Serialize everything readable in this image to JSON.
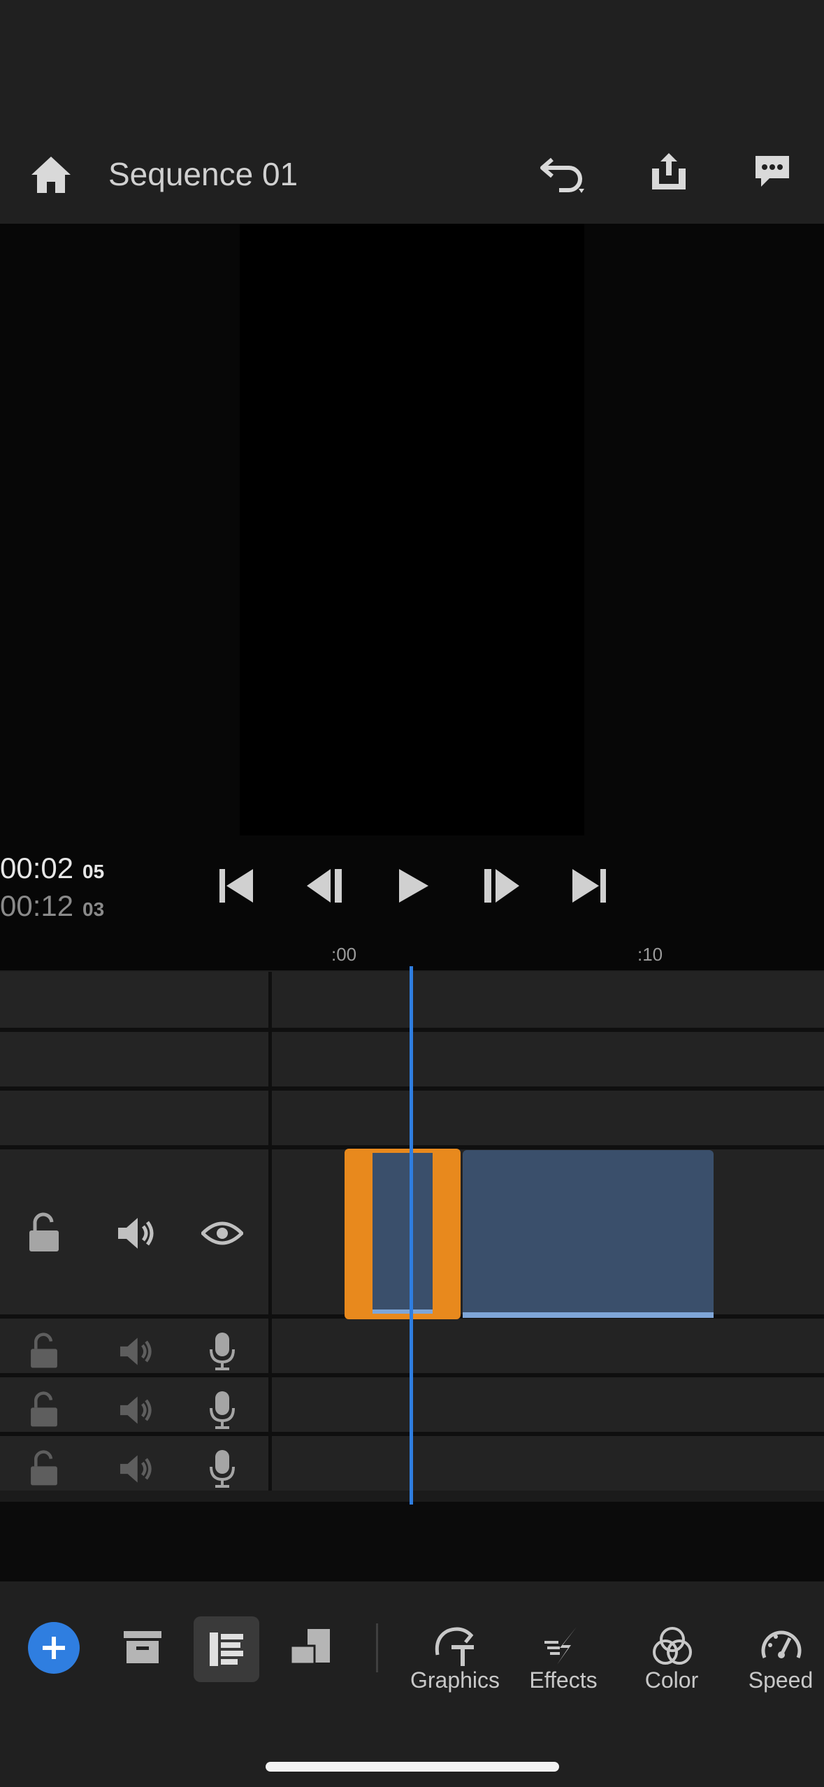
{
  "header": {
    "title": "Sequence 01",
    "icons": [
      "home-icon",
      "undo-icon",
      "share-icon",
      "feedback-icon"
    ]
  },
  "viewer": {
    "current_time": "00:02",
    "current_frames": "05",
    "total_time": "00:12",
    "total_frames": "03"
  },
  "transport": [
    "skip-to-start-icon",
    "step-back-icon",
    "play-icon",
    "step-forward-icon",
    "skip-to-end-icon"
  ],
  "ruler": {
    "labels": [
      ":00",
      ":10"
    ]
  },
  "tracks": {
    "video_controls": [
      "lock-icon",
      "volume-icon",
      "eye-icon"
    ],
    "audio_controls": [
      "lock-icon",
      "volume-icon",
      "microphone-icon"
    ],
    "clips": [
      {
        "name": "clip-1",
        "selected": true
      },
      {
        "name": "clip-2",
        "selected": false
      }
    ]
  },
  "toolbar": {
    "tools": [
      {
        "label": "Graphics",
        "icon": "graphics-icon"
      },
      {
        "label": "Effects",
        "icon": "effects-icon"
      },
      {
        "label": "Color",
        "icon": "color-icon"
      },
      {
        "label": "Speed",
        "icon": "speed-icon"
      }
    ],
    "left_icons": [
      "add-icon",
      "media-icon",
      "timeline-icon",
      "aspect-ratio-icon"
    ]
  },
  "colors": {
    "accent_blue": "#2f7ee0",
    "selected_clip": "#e8891d",
    "clip_fill": "#3a4f6b"
  }
}
